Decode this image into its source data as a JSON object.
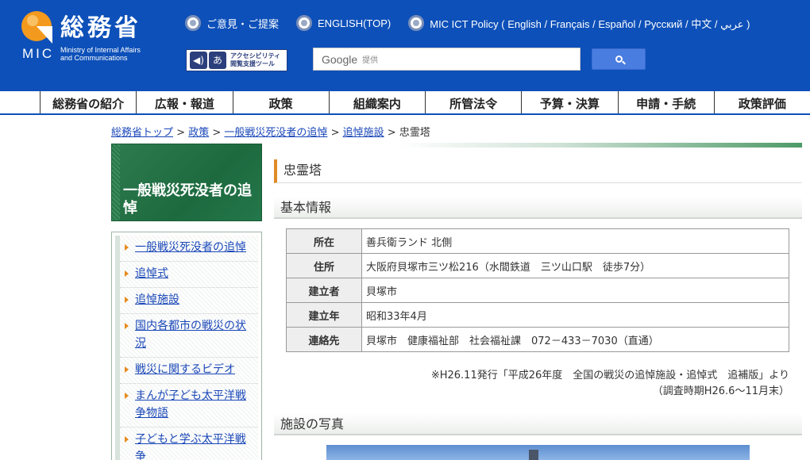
{
  "header": {
    "logo_jp": "総務省",
    "logo_mic": "MIC",
    "logo_en_1": "Ministry of Internal Affairs",
    "logo_en_2": "and Communications",
    "top_links": [
      {
        "label": "ご意見・ご提案"
      },
      {
        "label": "ENGLISH(TOP)"
      },
      {
        "label": "MIC ICT Policy ( English / Français / Español / Русский / 中文 / عربي )"
      }
    ],
    "accessibility": {
      "icon1": "◀)",
      "icon2": "あ",
      "line1": "アクセシビリティ",
      "line2": "閲覧支援ツール"
    },
    "search": {
      "brand": "Google",
      "provided": "提供"
    }
  },
  "nav": {
    "items": [
      "総務省の紹介",
      "広報・報道",
      "政策",
      "組織案内",
      "所管法令",
      "予算・決算",
      "申請・手続",
      "政策評価"
    ]
  },
  "breadcrumb": {
    "items": [
      "総務省トップ",
      "政策",
      "一般戦災死没者の追悼",
      "追悼施設"
    ],
    "current": "忠霊塔",
    "sep": ">"
  },
  "sidebar": {
    "title": "一般戦災死没者の追悼",
    "items": [
      {
        "label": "一般戦災死没者の追悼"
      },
      {
        "label": "追悼式"
      },
      {
        "label": "追悼施設"
      },
      {
        "label": "国内各都市の戦災の状況"
      },
      {
        "label": "戦災に関するビデオ"
      },
      {
        "label": "まんが子ども太平洋戦争物語"
      },
      {
        "label": "子どもと学ぶ太平洋戦争"
      }
    ]
  },
  "main": {
    "title": "忠霊塔",
    "basic_info_heading": "基本情報",
    "table": [
      {
        "label": "所在",
        "value": "善兵衛ランド 北側"
      },
      {
        "label": "住所",
        "value": "大阪府貝塚市三ツ松216（水間鉄道　三ツ山口駅　徒歩7分）"
      },
      {
        "label": "建立者",
        "value": "貝塚市"
      },
      {
        "label": "建立年",
        "value": "昭和33年4月"
      },
      {
        "label": "連絡先",
        "value": "貝塚市　健康福祉部　社会福祉課　072－433－7030（直通）"
      }
    ],
    "note_1": "※H26.11発行「平成26年度　全国の戦災の追悼施設・追悼式　追補版」より",
    "note_2": "（調査時期H26.6〜11月末）",
    "photo_heading": "施設の写真"
  },
  "colors": {
    "header_blue": "#0d50b9",
    "banner_green": "#2e7b50",
    "title_accent": "#e08a28",
    "link": "#1a47b8"
  }
}
